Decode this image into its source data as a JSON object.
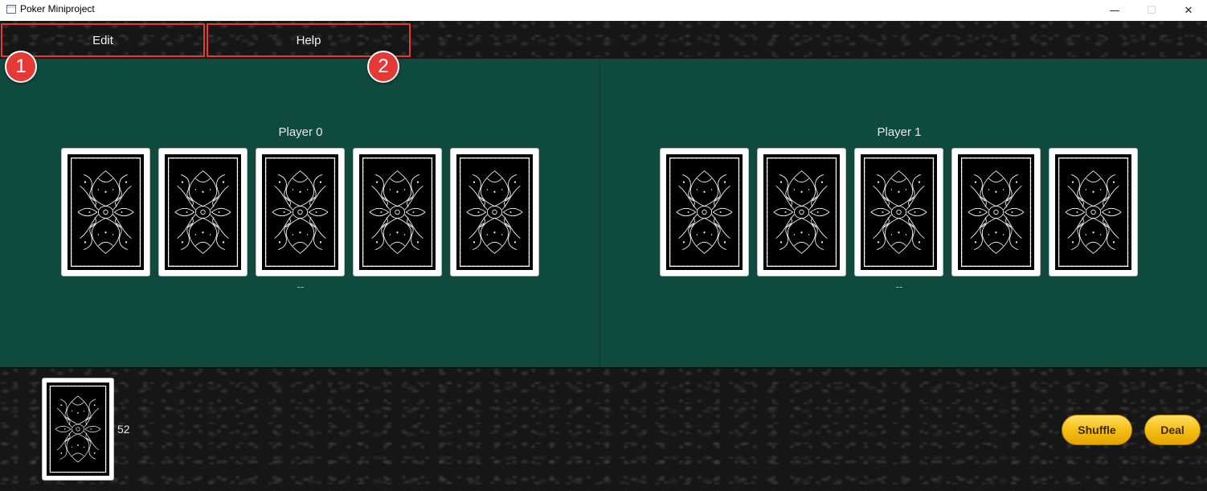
{
  "window": {
    "title": "Poker Miniproject",
    "minimize_glyph": "—",
    "maximize_glyph": "☐",
    "close_glyph": "✕"
  },
  "menu": {
    "items": [
      {
        "label": "Edit"
      },
      {
        "label": "Help"
      }
    ]
  },
  "callouts": [
    "1",
    "2"
  ],
  "players": [
    {
      "name": "Player 0",
      "evaluation": "--",
      "cards": [
        "card-back",
        "card-back",
        "card-back",
        "card-back",
        "card-back"
      ]
    },
    {
      "name": "Player 1",
      "evaluation": "--",
      "cards": [
        "card-back",
        "card-back",
        "card-back",
        "card-back",
        "card-back"
      ]
    }
  ],
  "deck": {
    "count": "52"
  },
  "controls": {
    "shuffle_label": "Shuffle",
    "deal_label": "Deal"
  },
  "colors": {
    "table_felt": "#0f4a3f",
    "callout_red": "#e53935",
    "button_gold": "#f6c21a",
    "evaluation_text": "#d4c200"
  }
}
